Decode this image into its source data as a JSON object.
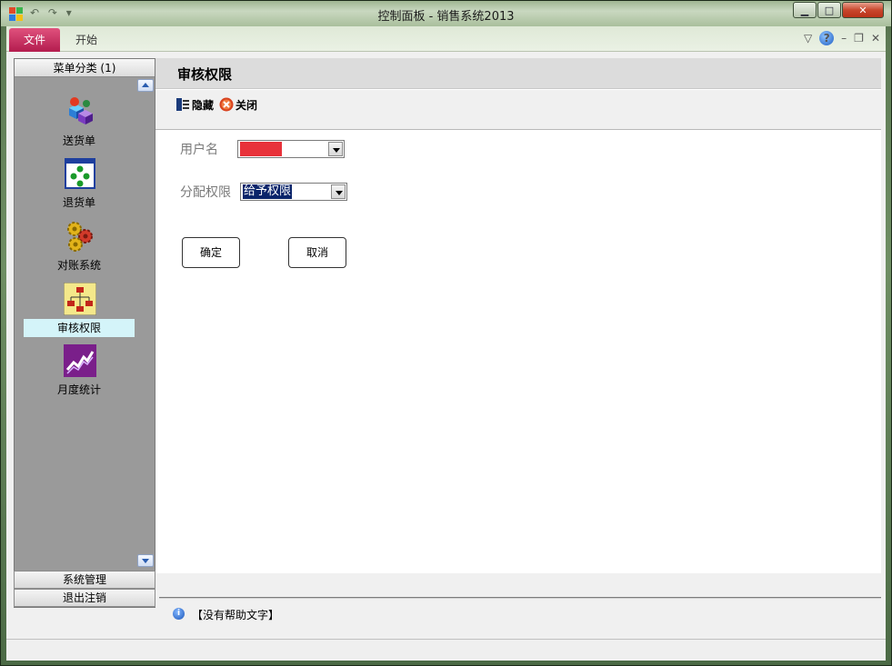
{
  "window": {
    "title": "控制面板 - 销售系统2013"
  },
  "ribbon": {
    "file_tab": "文件",
    "start_tab": "开始"
  },
  "sidebar": {
    "header": "菜单分类 (1)",
    "items": [
      {
        "label": "送货单",
        "icon": "cubes-icon"
      },
      {
        "label": "退货单",
        "icon": "dots-window-icon"
      },
      {
        "label": "对账系统",
        "icon": "gears-icon"
      },
      {
        "label": "审核权限",
        "icon": "org-chart-icon",
        "active": true
      },
      {
        "label": "月度统计",
        "icon": "trend-chart-icon"
      }
    ],
    "groups": [
      "系统管理",
      "退出注销"
    ]
  },
  "main": {
    "title": "审核权限",
    "toolbar": {
      "hide": "隐藏",
      "close": "关闭"
    },
    "form": {
      "username_label": "用户名",
      "username_value": "",
      "permission_label": "分配权限",
      "permission_value": "给予权限"
    },
    "buttons": {
      "ok": "确定",
      "cancel": "取消"
    }
  },
  "help": {
    "text": "【没有帮助文字】"
  },
  "colors": {
    "file_tab": "#b31c4e",
    "sidebar_bg": "#9a9a9a",
    "active_item": "#d4f4f9",
    "selection": "#0a246a"
  }
}
